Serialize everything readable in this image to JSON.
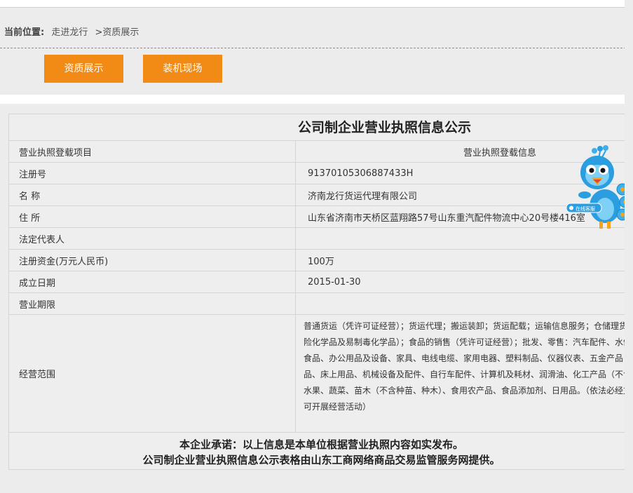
{
  "breadcrumb": {
    "label": "当前位置:",
    "home": "走进龙行",
    "separator": ">",
    "current": "资质展示"
  },
  "tabs": [
    {
      "label": "资质展示"
    },
    {
      "label": "装机现场"
    }
  ],
  "panel": {
    "title": "公司制企业营业执照信息公示",
    "header": {
      "left": "营业执照登载项目",
      "right": "营业执照登载信息"
    },
    "rows": [
      {
        "key": "注册号",
        "value": "91370105306887433H"
      },
      {
        "key": "名 称",
        "value": "济南龙行货运代理有限公司"
      },
      {
        "key": "住 所",
        "value": "山东省济南市天桥区蓝翔路57号山东重汽配件物流中心20号楼416室"
      },
      {
        "key": "法定代表人",
        "value": ""
      },
      {
        "key": "注册资金(万元人民币)",
        "value": "100万"
      },
      {
        "key": "成立日期",
        "value": "2015-01-30"
      },
      {
        "key": "营业期限",
        "value": ""
      }
    ],
    "scope": {
      "key": "经营范围",
      "value": "普通货运（凭许可证经营）；货运代理；搬运装卸；货运配载；运输信息服务；仓储理货险化学品及易制毒化学品）；食品的销售（凭许可证经营）；批发、零售：汽车配件、水健食品、办公用品及设备、家具、电线电缆、家用电器、塑料制品、仪器仪表、五金产品品、床上用品、机械设备及配件、自行车配件、计算机及耗材、润滑油、化工产品（不含水果、蔬菜、苗木（不含种苗、种木）、食用农产品、食品添加剂、日用品。（依法必经方可开展经营活动）"
    },
    "footer": {
      "line1": "本企业承诺：以上信息是本单位根据营业执照内容如实发布。",
      "line2": "公司制企业营业执照信息公示表格由山东工商网络商品交易监管服务网提供。"
    }
  },
  "mascot": {
    "badge": "在线客服"
  },
  "colors": {
    "accent": "#f28a16",
    "background": "#ececec",
    "mascot_blue": "#2a9ee0"
  }
}
